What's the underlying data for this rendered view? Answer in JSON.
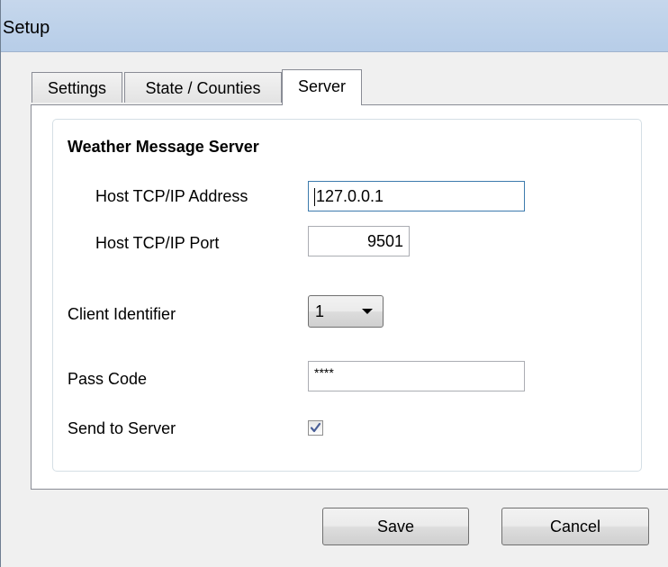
{
  "window": {
    "title": "Setup"
  },
  "tabs": [
    {
      "label": "Settings",
      "selected": false
    },
    {
      "label": "State / Counties",
      "selected": false
    },
    {
      "label": "Server",
      "selected": true
    }
  ],
  "server": {
    "group_title": "Weather Message Server",
    "host_address_label": "Host TCP/IP Address",
    "host_address_value": "127.0.0.1",
    "host_port_label": "Host TCP/IP Port",
    "host_port_value": "9501",
    "client_id_label": "Client Identifier",
    "client_id_value": "1",
    "pass_code_label": "Pass Code",
    "pass_code_value": "****",
    "send_to_server_label": "Send to Server",
    "send_to_server_checked": true
  },
  "buttons": {
    "save_label": "Save",
    "cancel_label": "Cancel"
  },
  "colors": {
    "titlebar": "#bed2ea",
    "focus_border": "#3d7bad",
    "check_mark": "#4a5f97"
  }
}
